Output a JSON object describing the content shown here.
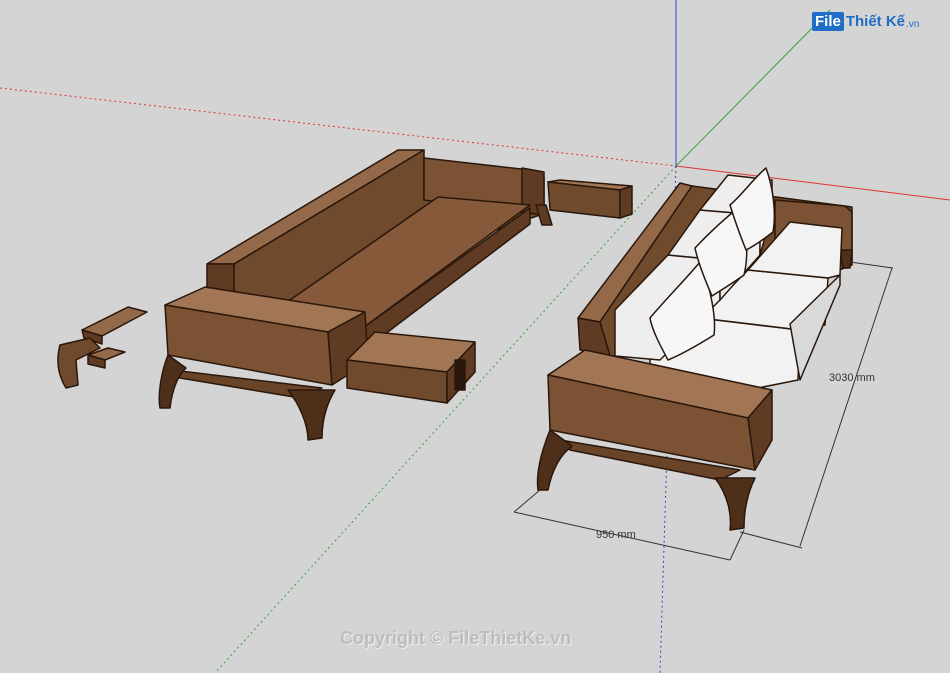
{
  "logo": {
    "file": "File",
    "rest": "Thiết Kế",
    "tld": ".vn"
  },
  "dimensions": {
    "depth": "950 mm",
    "length": "3030 mm"
  },
  "watermark": "Copyright © FileThietKe.vn",
  "colors": {
    "background": "#d4d4d4",
    "wood_dark": "#5e3b22",
    "wood_mid": "#7b5233",
    "wood_light": "#94694a",
    "cushion": "#f3f3f3",
    "axis_red": "#d33",
    "axis_green": "#3aa33a",
    "axis_blue": "#3344cc",
    "logo_blue": "#1e6ec8"
  }
}
